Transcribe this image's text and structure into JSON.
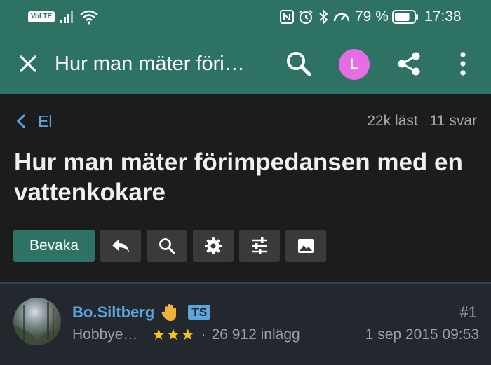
{
  "status_bar": {
    "volte": "VoLTE",
    "battery_percent": "79 %",
    "time": "17:38",
    "battery_level": 79
  },
  "app_bar": {
    "title": "Hur man mäter föri…",
    "avatar_letter": "L"
  },
  "thread": {
    "breadcrumb": "El",
    "views": "22k läst",
    "replies": "11 svar",
    "title": "Hur man mäter förimpedansen med en vattenkokare"
  },
  "toolbar": {
    "watch_label": "Bevaka"
  },
  "post": {
    "author": "Bo.Siltberg",
    "author_badge": "TS",
    "number": "#1",
    "role": "Hobbye…",
    "stars": "★★★",
    "post_count": "26 912 inlägg",
    "date": "1 sep 2015 09:53"
  },
  "colors": {
    "app_bar": "#2d7263",
    "header_bg": "#1c1c1c",
    "page_bg": "#22282e",
    "link": "#5ea5de",
    "avatar": "#e56ee5",
    "star": "#f5c518"
  },
  "icons": {
    "close": "close-icon",
    "search": "search-icon",
    "share": "share-icon",
    "more": "more-vertical-icon",
    "back": "chevron-left-icon",
    "reply": "reply-icon",
    "search_thread": "search-icon",
    "settings": "gear-icon",
    "filter": "sliders-icon",
    "image": "image-icon",
    "raised_hand": "raised-hand-icon"
  }
}
